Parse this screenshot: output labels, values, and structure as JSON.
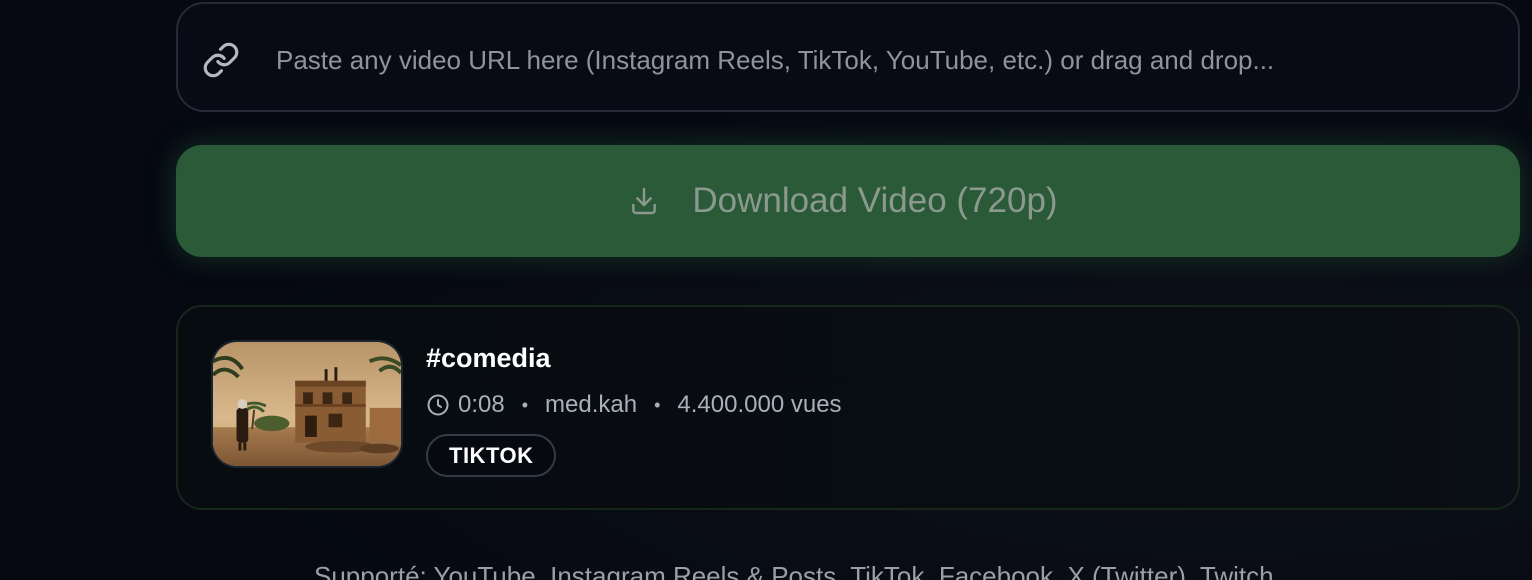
{
  "url_input": {
    "placeholder": "Paste any video URL here (Instagram Reels, TikTok, YouTube, etc.) or drag and drop...",
    "icon": "link-icon"
  },
  "download_button": {
    "label": "Download Video (720p)",
    "icon": "download-icon",
    "color": "#2a5a38"
  },
  "video": {
    "title": "#comedia",
    "duration": "0:08",
    "author": "med.kah",
    "views": "4.400.000 vues",
    "platform": "TIKTOK",
    "separator": "•"
  },
  "supported_text": "Supporté: YouTube, Instagram Reels & Posts, TikTok, Facebook, X (Twitter), Twitch"
}
